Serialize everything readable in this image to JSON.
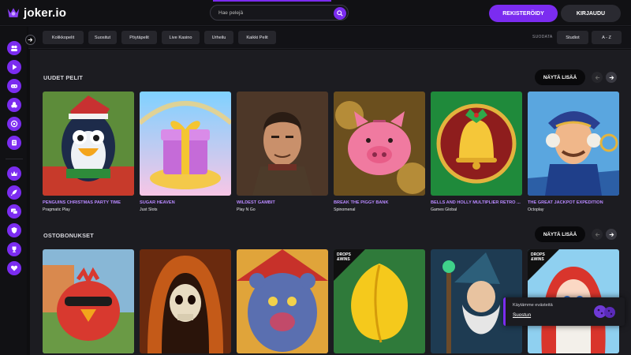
{
  "brand": {
    "name": "joker.io",
    "accent": "#7b2cf0"
  },
  "header": {
    "search_placeholder": "Hae pelejä",
    "register_label": "REKISTERÖIDY",
    "login_label": "KIRJAUDU"
  },
  "sidebar": {
    "top_icons": [
      "users-icon",
      "play-icon",
      "gamepad-icon",
      "chips-icon",
      "target-icon",
      "cards-icon"
    ],
    "bottom_icons": [
      "crown-icon",
      "rocket-icon",
      "chat-icon",
      "shield-icon",
      "trophy-icon",
      "heart-icon"
    ]
  },
  "filters": {
    "chips": [
      "Kolikkopelit",
      "Suositut",
      "Pöytäpelit",
      "Live Kasino",
      "Urheilu",
      "Kaikki Pelit"
    ],
    "filter_label": "SUODATA",
    "studios_label": "Studiot",
    "sort_label": "A - Z"
  },
  "sections": [
    {
      "title": "UUDET PELIT",
      "show_more": "NÄYTÄ LISÄÄ",
      "games": [
        {
          "title": "PENGUINS CHRISTMAS PARTY TIME",
          "provider": "Pragmatic Play"
        },
        {
          "title": "SUGAR HEAVEN",
          "provider": "Just Slots"
        },
        {
          "title": "WILDEST GAMBIT",
          "provider": "Play N Go"
        },
        {
          "title": "BREAK THE PIGGY BANK",
          "provider": "Spinomenal"
        },
        {
          "title": "BELLS AND HOLLY MULTIPLIER RETRO ...",
          "provider": "Games Global"
        },
        {
          "title": "THE GREAT JACKPOT EXPEDITION",
          "provider": "Octoplay"
        }
      ]
    },
    {
      "title": "OSTOBONUKSET",
      "show_more": "NÄYTÄ LISÄÄ",
      "games": []
    }
  ],
  "badge": {
    "line1": "DROPS",
    "line2": "&WINS"
  },
  "cookie": {
    "text": "Käytämme evästeitä",
    "accept": "Suostun"
  }
}
